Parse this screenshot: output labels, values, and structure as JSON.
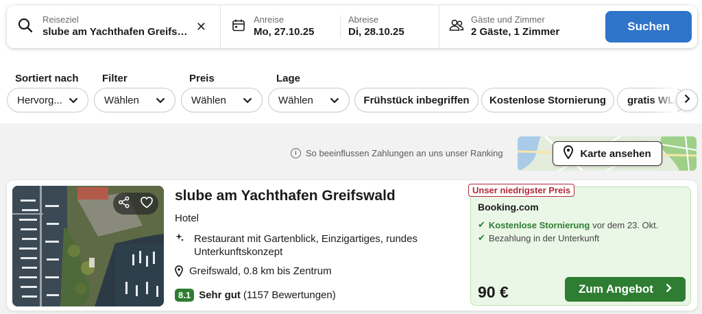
{
  "search": {
    "destination_label": "Reiseziel",
    "destination_value": "slube am Yachthafen Greifswald",
    "checkin_label": "Anreise",
    "checkin_value": "Mo, 27.10.25",
    "checkout_label": "Abreise",
    "checkout_value": "Di, 28.10.25",
    "guests_label": "Gäste und Zimmer",
    "guests_value": "2 Gäste, 1 Zimmer",
    "search_button": "Suchen"
  },
  "filters": {
    "sort_title": "Sortiert nach",
    "sort_value": "Hervorg...",
    "filter_title": "Filter",
    "filter_value": "Wählen",
    "price_title": "Preis",
    "price_value": "Wählen",
    "location_title": "Lage",
    "location_value": "Wählen",
    "chips": [
      "Frühstück inbegriffen",
      "Kostenlose Stornierung",
      "gratis WLAN"
    ]
  },
  "ranking": {
    "info_text": "So beeinflussen Zahlungen an uns unser Ranking",
    "map_button": "Karte ansehen"
  },
  "hotel": {
    "name": "slube am Yachthafen Greifswald",
    "type": "Hotel",
    "feature": "Restaurant mit Gartenblick, Einzigartiges, rundes Unterkunftskonzept",
    "location": "Greifswald, 0.8 km bis Zentrum",
    "rating_score": "8.1",
    "rating_word": "Sehr gut",
    "rating_count": "(1157 Bewertungen)"
  },
  "offer": {
    "badge": "Unser niedrigster Preis",
    "provider": "Booking.com",
    "perk1_highlight": "Kostenlose Stornierung",
    "perk1_rest": "vor dem 23. Okt.",
    "perk2": "Bezahlung in der Unterkunft",
    "price": "90 €",
    "button": "Zum Angebot"
  },
  "colors": {
    "primary_blue": "#2e75c9",
    "deal_green": "#2e7d32",
    "badge_red": "#b02a37",
    "offer_bg": "#eaf6e6"
  }
}
